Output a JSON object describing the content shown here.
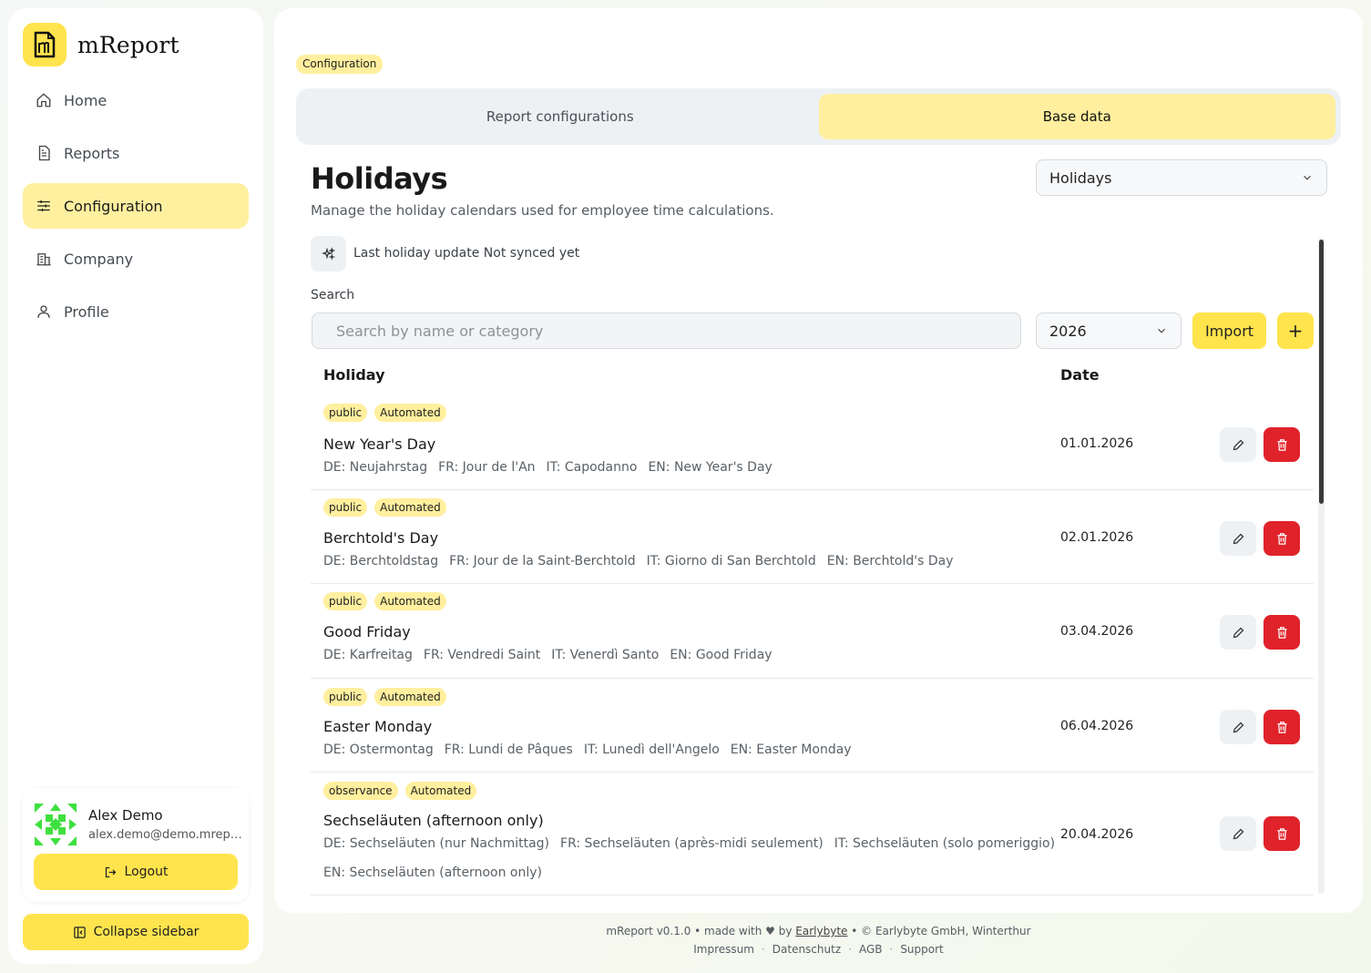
{
  "app": {
    "name": "mReport"
  },
  "nav": [
    {
      "label": "Home",
      "icon": "home-icon",
      "active": false
    },
    {
      "label": "Reports",
      "icon": "report-icon",
      "active": false
    },
    {
      "label": "Configuration",
      "icon": "sliders-icon",
      "active": true
    },
    {
      "label": "Company",
      "icon": "building-icon",
      "active": false
    },
    {
      "label": "Profile",
      "icon": "user-icon",
      "active": false
    }
  ],
  "user": {
    "name": "Alex Demo",
    "email": "alex.demo@demo.mreport.ch",
    "logout_label": "Logout"
  },
  "collapse_label": "Collapse sidebar",
  "breadcrumb": "Configuration",
  "tabs": [
    {
      "label": "Report configurations",
      "active": false
    },
    {
      "label": "Base data",
      "active": true
    }
  ],
  "page": {
    "title": "Holidays",
    "subtitle": "Manage the holiday calendars used for employee time calculations.",
    "type_select": "Holidays",
    "sync_text": "Last holiday update Not synced yet"
  },
  "search": {
    "label": "Search",
    "placeholder": "Search by name or category"
  },
  "year_select": "2026",
  "import_label": "Import",
  "add_label": "+",
  "table": {
    "headers": {
      "holiday": "Holiday",
      "date": "Date"
    },
    "rows": [
      {
        "badges": [
          "public",
          "Automated"
        ],
        "name": "New Year's Day",
        "translations": [
          "DE: Neujahrstag",
          "FR: Jour de l'An",
          "IT: Capodanno",
          "EN: New Year's Day"
        ],
        "date": "01.01.2026"
      },
      {
        "badges": [
          "public",
          "Automated"
        ],
        "name": "Berchtold's Day",
        "translations": [
          "DE: Berchtoldstag",
          "FR: Jour de la Saint-Berchtold",
          "IT: Giorno di San Berchtold",
          "EN: Berchtold's Day"
        ],
        "date": "02.01.2026"
      },
      {
        "badges": [
          "public",
          "Automated"
        ],
        "name": "Good Friday",
        "translations": [
          "DE: Karfreitag",
          "FR: Vendredi Saint",
          "IT: Venerdì Santo",
          "EN: Good Friday"
        ],
        "date": "03.04.2026"
      },
      {
        "badges": [
          "public",
          "Automated"
        ],
        "name": "Easter Monday",
        "translations": [
          "DE: Ostermontag",
          "FR: Lundi de Pâques",
          "IT: Lunedì dell'Angelo",
          "EN: Easter Monday"
        ],
        "date": "06.04.2026"
      },
      {
        "badges": [
          "observance",
          "Automated"
        ],
        "name": "Sechseläuten (afternoon only)",
        "translations": [
          "DE: Sechseläuten (nur Nachmittag)",
          "FR: Sechseläuten (après-midi seulement)",
          "IT: Sechseläuten (solo pomeriggio)"
        ],
        "translations2": [
          "EN: Sechseläuten (afternoon only)"
        ],
        "date": "20.04.2026"
      }
    ]
  },
  "footer": {
    "prefix": "mReport v0.1.0 • made with ♥ by",
    "brand_link": "Earlybyte",
    "suffix": "• © Earlybyte GmbH, Winterthur",
    "links": [
      "Impressum",
      "Datenschutz",
      "AGB",
      "Support"
    ]
  },
  "colors": {
    "accent": "#ffe44d",
    "accent_soft": "#ffef9e",
    "danger": "#e0232a"
  }
}
